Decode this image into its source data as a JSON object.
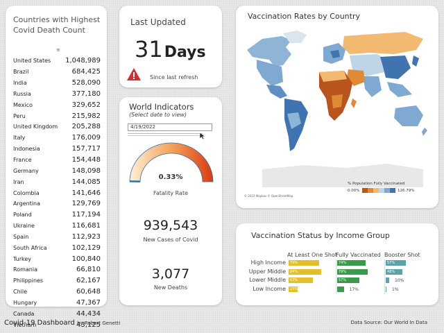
{
  "countries_card": {
    "title": "Countries with Highest Covid Death Count",
    "rows": [
      {
        "country": "United States",
        "deaths": "1,048,989"
      },
      {
        "country": "Brazil",
        "deaths": "684,425"
      },
      {
        "country": "India",
        "deaths": "528,090"
      },
      {
        "country": "Russia",
        "deaths": "377,180"
      },
      {
        "country": "Mexico",
        "deaths": "329,652"
      },
      {
        "country": "Peru",
        "deaths": "215,982"
      },
      {
        "country": "United Kingdom",
        "deaths": "205,288"
      },
      {
        "country": "Italy",
        "deaths": "176,009"
      },
      {
        "country": "Indonesia",
        "deaths": "157,717"
      },
      {
        "country": "France",
        "deaths": "154,448"
      },
      {
        "country": "Germany",
        "deaths": "148,098"
      },
      {
        "country": "Iran",
        "deaths": "144,085"
      },
      {
        "country": "Colombia",
        "deaths": "141,646"
      },
      {
        "country": "Argentina",
        "deaths": "129,769"
      },
      {
        "country": "Poland",
        "deaths": "117,194"
      },
      {
        "country": "Ukraine",
        "deaths": "116,681"
      },
      {
        "country": "Spain",
        "deaths": "112,923"
      },
      {
        "country": "South Africa",
        "deaths": "102,129"
      },
      {
        "country": "Turkey",
        "deaths": "100,840"
      },
      {
        "country": "Romania",
        "deaths": "66,810"
      },
      {
        "country": "Philippines",
        "deaths": "62,167"
      },
      {
        "country": "Chile",
        "deaths": "60,648"
      },
      {
        "country": "Hungary",
        "deaths": "47,367"
      },
      {
        "country": "Canada",
        "deaths": "44,434"
      },
      {
        "country": "Vietnam",
        "deaths": "43,125"
      }
    ],
    "sort_icon": "sort-icon"
  },
  "last_updated": {
    "title": "Last Updated",
    "value": "31",
    "unit": "Days",
    "warning_icon": "warning-triangle-icon",
    "note": "Since last refresh"
  },
  "world_indicators": {
    "title": "World Indicators",
    "subtitle": "(Select date to view)",
    "date_value": "4/19/2022",
    "gauge_fraction": 0.0033,
    "gauge_value": "0.33%",
    "gauge_label": "Fatality Rate",
    "new_cases": "939,543",
    "new_cases_label": "New Cases of Covid",
    "new_deaths": "3,077",
    "new_deaths_label": "New Deaths"
  },
  "vaccination_map": {
    "title": "Vaccination Rates by Country",
    "legend_title": "% Population Fully Vaccinated",
    "legend_min": "0.00%",
    "legend_max": "126.79%",
    "credit": "© 2022 Mapbox © OpenStreetMap",
    "colors": [
      "#b9541c",
      "#e08a36",
      "#f2b970",
      "#bfd4e6",
      "#7fa9d0",
      "#3f74b0"
    ]
  },
  "income_group": {
    "title": "Vaccination Status by Income Group",
    "columns": [
      "At Least One Shot",
      "Fully Vaccinated",
      "Booster Shot"
    ],
    "rows": [
      {
        "label": "High Income",
        "one_shot": 79,
        "one_shot_label": "79%",
        "full": 74,
        "full_label": "74%",
        "booster": 57,
        "booster_label": "57%"
      },
      {
        "label": "Upper Middle",
        "one_shot": 84,
        "one_shot_label": "84%",
        "full": 79,
        "full_label": "79%",
        "booster": 48,
        "booster_label": "48%"
      },
      {
        "label": "Lower Middle",
        "one_shot": 63,
        "one_shot_label": "63%",
        "full": 57,
        "full_label": "57%",
        "booster": 10,
        "booster_label": "10%"
      },
      {
        "label": "Low Income",
        "one_shot": 23,
        "one_shot_label": "23%",
        "full": 17,
        "full_label": "17%",
        "booster": 1,
        "booster_label": "1%"
      }
    ],
    "colors": {
      "one_shot": "#e3c02b",
      "full": "#3b9a4c",
      "booster": "#5aa3a8"
    }
  },
  "footer": {
    "title": "Covid-19 Dashboard",
    "author": "by Robert Genetti",
    "source": "Data Source: Our World In Data"
  }
}
